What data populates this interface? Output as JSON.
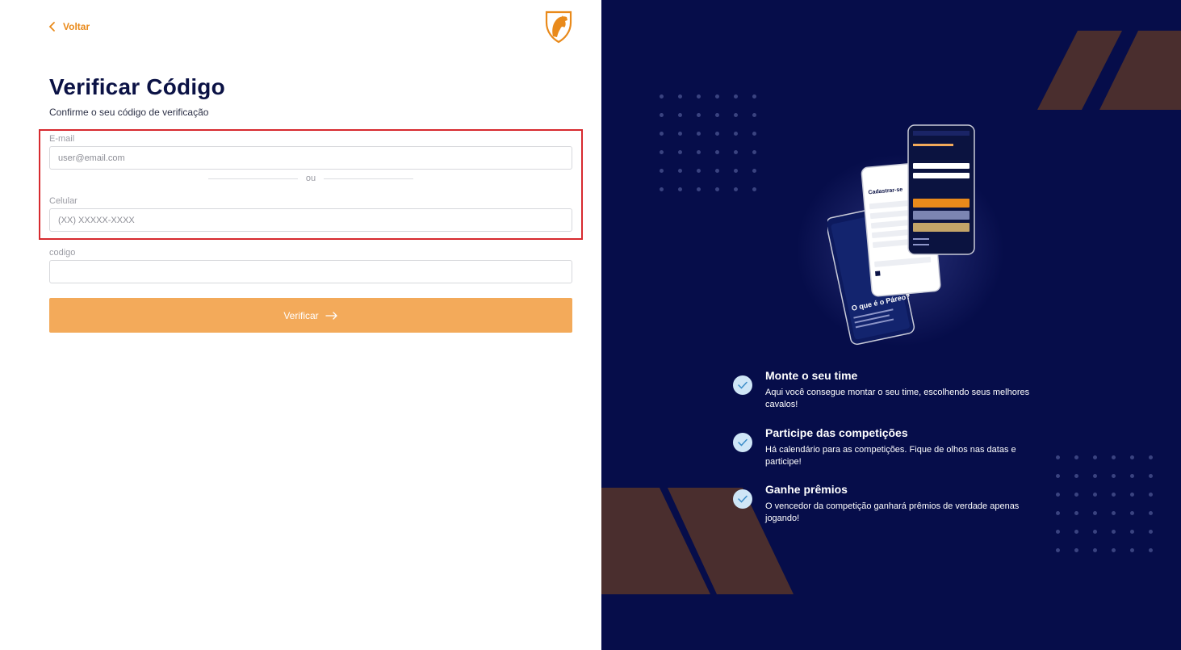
{
  "nav": {
    "back_label": "Voltar"
  },
  "header": {
    "title": "Verificar Código",
    "subtitle": "Confirme o seu código de verificação"
  },
  "form": {
    "email_label": "E-mail",
    "email_placeholder": "user@email.com",
    "divider_text": "ou",
    "phone_label": "Celular",
    "phone_placeholder": "(XX) XXXXX-XXXX",
    "code_label": "codigo",
    "code_value": "",
    "submit_label": "Verificar"
  },
  "promo": {
    "phone_screen_title": "Cadastrar-se",
    "phone_screen_tagline": "O que é o Páreo?",
    "features": [
      {
        "title": "Monte o seu time",
        "description": "Aqui você consegue montar o seu time, escolhendo seus melhores cavalos!"
      },
      {
        "title": "Participe das competições",
        "description": "Há calendário para as competições. Fique de olhos nas datas e participe!"
      },
      {
        "title": "Ganhe prêmios",
        "description": "O vencedor da competição ganhará prêmios de verdade apenas jogando!"
      }
    ]
  },
  "colors": {
    "accent": "#e98a1b",
    "button": "#f3aa5a",
    "panel_bg": "#060d4a",
    "highlight": "#d72a2f",
    "shape_brown": "#4a2e2e"
  },
  "icons": {
    "back": "chevron-left-icon",
    "logo": "horse-shield-logo",
    "submit": "arrow-right-icon",
    "feature": "check-circle-icon"
  }
}
